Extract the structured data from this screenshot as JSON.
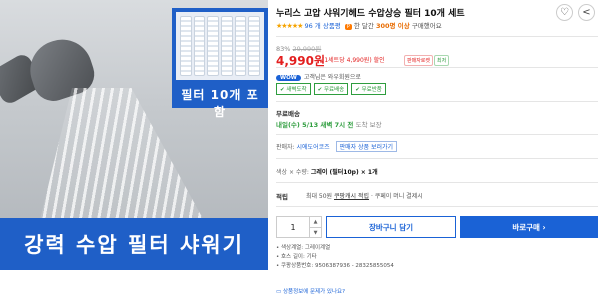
{
  "product_image": {
    "promo_label": "필터 10개 포함",
    "banner_text": "강력 수압 필터 샤워기"
  },
  "product": {
    "title": "누리스 고압 샤워기헤드 수압상승 필터 10개 세트",
    "rating": {
      "count_text": "96 개 상품평",
      "badge": "P",
      "month_text_prefix": "한 달간 ",
      "month_highlight": "300명 이상",
      "month_text_suffix": " 구매했어요"
    },
    "discount_rate": "83%",
    "original_price": "29,990원",
    "price": "4,990원",
    "unit_price": "(1세트당 4,990원) 할인",
    "tags": [
      "판매자로켓",
      "최저"
    ],
    "wow": {
      "pill": "WOW",
      "text": "고객님은 와우회원으로"
    },
    "benefits": [
      "✔ 새벽도착",
      "✔ 무료배송",
      "✔ 무료반품"
    ],
    "delivery": {
      "free": "무료배송",
      "eta": "내일(수) 5/13 새벽 7시 전",
      "eta_note": "도착 보장"
    },
    "seller": {
      "label": "판매자:",
      "name": "시에도어코즈",
      "button": "판매자 상품 보러가기"
    },
    "option": {
      "label": "색상 × 수량:",
      "value": "그레이 (필터10p) × 1개"
    },
    "points": {
      "label": "적립",
      "max": "최대 50원",
      "cash": "쿠팡캐시 적립",
      "extra": "· 쿠페이 머니 결제시"
    },
    "quantity": "1",
    "cart_label": "장바구니 담기",
    "buy_label": "바로구매 ›",
    "details": [
      "색상계열: 그레이계열",
      "호스 길이: 기타",
      "쿠팡상품번호: 9506387936 - 28325855054"
    ],
    "feedback_link": "상품정보에 문제가 있나요?"
  },
  "icons": [
    "heart-icon",
    "share-icon"
  ],
  "colors": {
    "accent": "#1a62d6",
    "price": "#e31f1f",
    "green": "#2e9d3e",
    "banner": "#1f5fc7"
  }
}
